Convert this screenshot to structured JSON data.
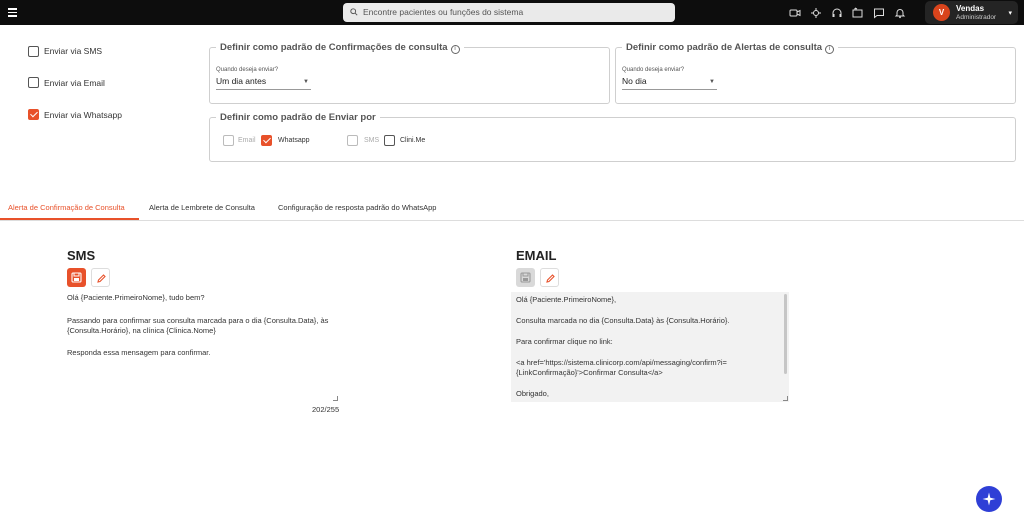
{
  "topbar": {
    "search_placeholder": "Encontre pacientes ou funções do sistema",
    "icons": [
      "video-icon",
      "bug-icon",
      "headset-icon",
      "history-icon",
      "chat-icon",
      "bell-icon"
    ],
    "user": {
      "initial": "V",
      "name": "Vendas",
      "role": "Administrador"
    }
  },
  "channels": [
    {
      "label": "Enviar via SMS",
      "checked": false
    },
    {
      "label": "Enviar via Email",
      "checked": false
    },
    {
      "label": "Enviar via Whatsapp",
      "checked": true
    }
  ],
  "confirm_default": {
    "legend": "Definir como padrão de Confirmações de consulta",
    "caption": "Quando deseja enviar?",
    "value": "Um dia antes"
  },
  "alert_default": {
    "legend": "Definir como padrão de Alertas de consulta",
    "caption": "Quando deseja enviar?",
    "value": "No dia"
  },
  "send_by": {
    "legend": "Definir como padrão de Enviar por",
    "options": [
      {
        "label": "Email",
        "checked": false,
        "enabled": false
      },
      {
        "label": "Whatsapp",
        "checked": true,
        "enabled": true
      },
      {
        "label": "SMS",
        "checked": false,
        "enabled": false
      },
      {
        "label": "Clini.Me",
        "checked": false,
        "enabled": true
      }
    ]
  },
  "tabs": [
    {
      "label": "Alerta de Confirmação de Consulta",
      "active": true
    },
    {
      "label": "Alerta de Lembrete de Consulta",
      "active": false
    },
    {
      "label": "Configuração de resposta padrão do WhatsApp",
      "active": false
    }
  ],
  "sms": {
    "title": "SMS",
    "lines": [
      "Olá {Paciente.PrimeiroNome}, tudo bem?",
      "",
      "Passando para confirmar sua consulta marcada para o dia {Consulta.Data}, às",
      "{Consulta.Horário}, na clínica {Clinica.Nome}",
      "",
      "Responda essa mensagem para confirmar."
    ],
    "counter": "202/255"
  },
  "email": {
    "title": "EMAIL",
    "lines": [
      "Olá {Paciente.PrimeiroNome},",
      "",
      "Consulta marcada no dia {Consulta.Data} às {Consulta.Horário}.",
      "",
      "Para confirmar clique no link:",
      "",
      "<a href='https://sistema.clinicorp.com/api/messaging/confirm?i=",
      "{LinkConfirmação}'>Confirmar Consulta</a>",
      "",
      "Obrigado,"
    ]
  },
  "colors": {
    "accent": "#e8512a",
    "topbar": "#0d0d0d",
    "fab": "#2f3fd6"
  }
}
